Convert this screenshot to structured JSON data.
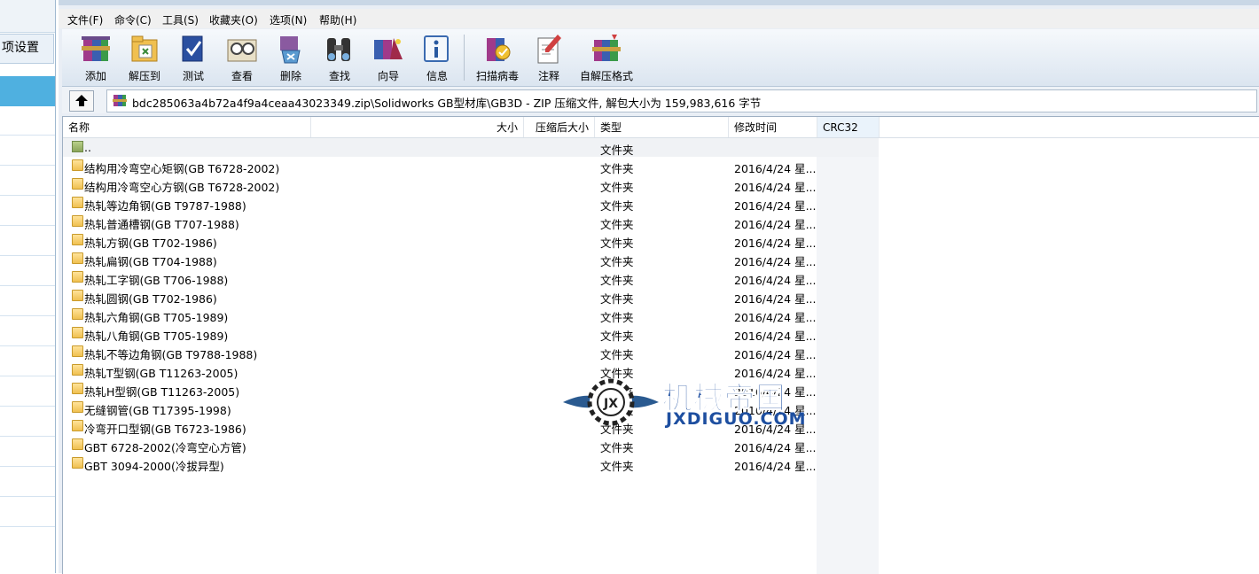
{
  "left_panel": {
    "tab_label": "项设置"
  },
  "menu": [
    "文件(F)",
    "命令(C)",
    "工具(S)",
    "收藏夹(O)",
    "选项(N)",
    "帮助(H)"
  ],
  "toolbar": {
    "buttons": [
      {
        "label": "添加",
        "icon": "add-archive-icon"
      },
      {
        "label": "解压到",
        "icon": "extract-to-icon"
      },
      {
        "label": "测试",
        "icon": "test-icon"
      },
      {
        "label": "查看",
        "icon": "view-icon"
      },
      {
        "label": "删除",
        "icon": "delete-icon"
      },
      {
        "label": "查找",
        "icon": "find-icon"
      },
      {
        "label": "向导",
        "icon": "wizard-icon"
      },
      {
        "label": "信息",
        "icon": "info-icon"
      },
      {
        "label": "扫描病毒",
        "icon": "virus-scan-icon"
      },
      {
        "label": "注释",
        "icon": "comment-icon"
      },
      {
        "label": "自解压格式",
        "icon": "sfx-icon"
      }
    ]
  },
  "address": "bdc285063a4b72a4f9a4ceaa43023349.zip\\Solidworks GB型材库\\GB3D - ZIP 压缩文件, 解包大小为 159,983,616 字节",
  "columns": {
    "name": "名称",
    "size": "大小",
    "packed": "压缩后大小",
    "type": "类型",
    "modified": "修改时间",
    "crc": "CRC32"
  },
  "parent_row": {
    "name": "..",
    "type": "文件夹"
  },
  "files": [
    {
      "name": "结构用冷弯空心矩钢(GB T6728-2002)",
      "type": "文件夹",
      "modified": "2016/4/24 星..."
    },
    {
      "name": "结构用冷弯空心方钢(GB T6728-2002)",
      "type": "文件夹",
      "modified": "2016/4/24 星..."
    },
    {
      "name": "热轧等边角钢(GB T9787-1988)",
      "type": "文件夹",
      "modified": "2016/4/24 星..."
    },
    {
      "name": "热轧普通槽钢(GB T707-1988)",
      "type": "文件夹",
      "modified": "2016/4/24 星..."
    },
    {
      "name": "热轧方钢(GB T702-1986)",
      "type": "文件夹",
      "modified": "2016/4/24 星..."
    },
    {
      "name": "热轧扁钢(GB T704-1988)",
      "type": "文件夹",
      "modified": "2016/4/24 星..."
    },
    {
      "name": "热轧工字钢(GB T706-1988)",
      "type": "文件夹",
      "modified": "2016/4/24 星..."
    },
    {
      "name": "热轧圆钢(GB T702-1986)",
      "type": "文件夹",
      "modified": "2016/4/24 星..."
    },
    {
      "name": "热轧六角钢(GB T705-1989)",
      "type": "文件夹",
      "modified": "2016/4/24 星..."
    },
    {
      "name": "热轧八角钢(GB T705-1989)",
      "type": "文件夹",
      "modified": "2016/4/24 星..."
    },
    {
      "name": "热轧不等边角钢(GB T9788-1988)",
      "type": "文件夹",
      "modified": "2016/4/24 星..."
    },
    {
      "name": "热轧T型钢(GB T11263-2005)",
      "type": "文件夹",
      "modified": "2016/4/24 星..."
    },
    {
      "name": "热轧H型钢(GB T11263-2005)",
      "type": "文件夹",
      "modified": "2016/4/24 星..."
    },
    {
      "name": "无缝钢管(GB T17395-1998)",
      "type": "文件夹",
      "modified": "2016/4/24 星..."
    },
    {
      "name": "冷弯开口型钢(GB T6723-1986)",
      "type": "文件夹",
      "modified": "2016/4/24 星..."
    },
    {
      "name": "GBT 6728-2002(冷弯空心方管)",
      "type": "文件夹",
      "modified": "2016/4/24 星..."
    },
    {
      "name": "GBT 3094-2000(冷拔异型)",
      "type": "文件夹",
      "modified": "2016/4/24 星..."
    }
  ],
  "watermark": {
    "title": "机械帝国",
    "url": "JXDIGUO.COM",
    "badge": "JX"
  }
}
